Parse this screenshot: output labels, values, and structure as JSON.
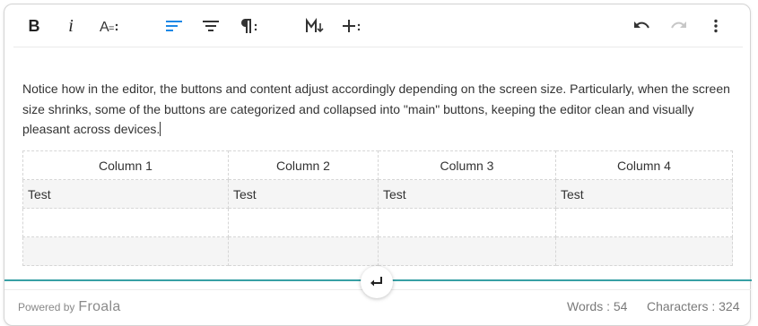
{
  "toolbar": {
    "bold_label": "B",
    "italic_label": "i",
    "active_color": "#1e88e5",
    "buttons": [
      "bold-icon",
      "italic-icon",
      "text-format-more-icon",
      "align-left-icon",
      "align-center-icon",
      "paragraph-more-icon",
      "markdown-icon",
      "insert-more-icon",
      "undo-icon",
      "redo-icon",
      "more-vertical-icon"
    ]
  },
  "editor": {
    "paragraph": "Notice how in the editor, the buttons and content adjust accordingly depending on the screen size. Particularly, when the screen size shrinks, some of the buttons are categorized and collapsed into \"main\" buttons, keeping the editor clean and visually pleasant across devices."
  },
  "table": {
    "headers": [
      "Column 1",
      "Column 2",
      "Column 3",
      "Column 4"
    ],
    "rows": [
      [
        "Test",
        "Test",
        "Test",
        "Test"
      ],
      [
        "",
        "",
        "",
        ""
      ],
      [
        "",
        "",
        "",
        ""
      ]
    ]
  },
  "footer": {
    "powered_by": "Powered by",
    "brand": "Froala",
    "words": "Words : 54",
    "characters": "Characters : 324",
    "accent_color": "#37a0a5"
  }
}
